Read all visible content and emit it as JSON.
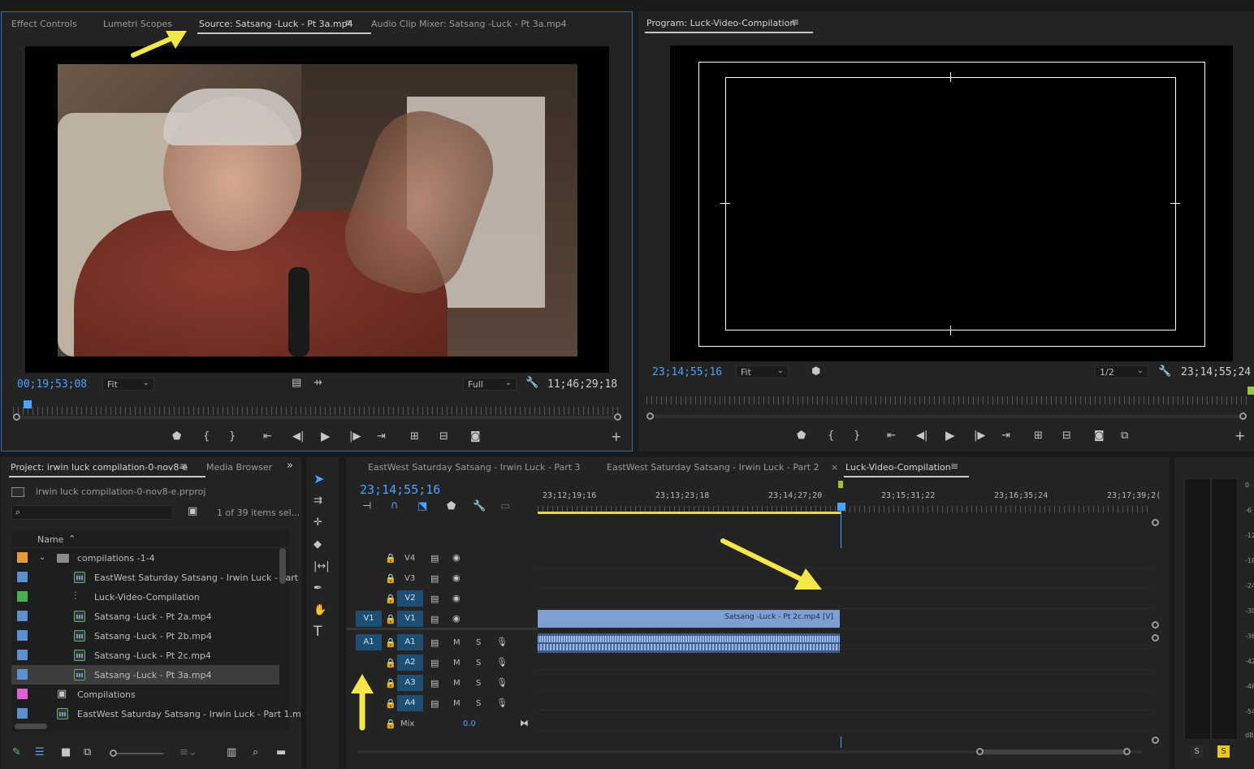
{
  "source_panel": {
    "tabs": [
      "Effect Controls",
      "Lumetri Scopes",
      "Source: Satsang -Luck - Pt 3a.mp4",
      "Audio Clip Mixer: Satsang -Luck - Pt 3a.mp4"
    ],
    "timecode": "00;19;53;08",
    "fit": "Fit",
    "quality": "Full",
    "duration": "11;46;29;18"
  },
  "program_panel": {
    "title": "Program: Luck-Video-Compilation",
    "timecode": "23;14;55;16",
    "fit": "Fit",
    "quality": "1/2",
    "duration": "23;14;55;24"
  },
  "project_panel": {
    "tabs": [
      "Project: irwin luck compilation-0-nov8-e",
      "Media Browser"
    ],
    "filename": "irwin luck compilation-0-nov8-e.prproj",
    "item_count": "1 of 39 items sel...",
    "column_name": "Name",
    "items": [
      {
        "label": "compilations -1-4",
        "color": "#e8993a",
        "kind": "folder"
      },
      {
        "label": "EastWest Saturday Satsang - Irwin Luck - Part",
        "color": "#5a8fd0",
        "kind": "sequence"
      },
      {
        "label": "Luck-Video-Compilation",
        "color": "#4cae4c",
        "kind": "multicam"
      },
      {
        "label": "Satsang -Luck - Pt 2a.mp4",
        "color": "#5a8fd0",
        "kind": "clip"
      },
      {
        "label": "Satsang -Luck - Pt 2b.mp4",
        "color": "#5a8fd0",
        "kind": "clip"
      },
      {
        "label": "Satsang -Luck - Pt 2c.mp4",
        "color": "#5a8fd0",
        "kind": "clip"
      },
      {
        "label": "Satsang -Luck - Pt 3a.mp4",
        "color": "#5a8fd0",
        "kind": "clip"
      },
      {
        "label": "Compilations",
        "color": "#e060d8",
        "kind": "bin"
      },
      {
        "label": "EastWest Saturday Satsang - Irwin Luck - Part 1.m",
        "color": "#5a8fd0",
        "kind": "clip"
      }
    ]
  },
  "timeline": {
    "tabs": [
      "EastWest Saturday Satsang - Irwin Luck - Part 3",
      "EastWest Saturday Satsang - Irwin Luck - Part 2",
      "Luck-Video-Compilation"
    ],
    "timecode": "23;14;55;16",
    "ruler_labels": [
      "23;12;19;16",
      "23;13;23;18",
      "23;14;27;20",
      "23;15;31;22",
      "23;16;35;24",
      "23;17;39;2("
    ],
    "video_tracks": [
      "V4",
      "V3",
      "V2",
      "V1"
    ],
    "audio_tracks": [
      "A1",
      "A2",
      "A3",
      "A4"
    ],
    "src_v": "V1",
    "src_a": "A1",
    "mute": "M",
    "solo": "S",
    "mix_label": "Mix",
    "mix_value": "0.0",
    "clip_label": "Satsang -Luck - Pt 2c.mp4 [V]"
  },
  "meter": {
    "scale": [
      "0",
      "-6",
      "-12",
      "-18",
      "-24",
      "-30",
      "-36",
      "-42",
      "-48",
      "-54",
      "dB"
    ],
    "solo_left": "S",
    "solo_right": "S"
  },
  "colors": {
    "accent": "#4aa3ff",
    "panel": "#232323",
    "track_btn": "#1d4f74",
    "clip": "#7d9fd2",
    "annotation_arrow": "#f5e64a"
  }
}
